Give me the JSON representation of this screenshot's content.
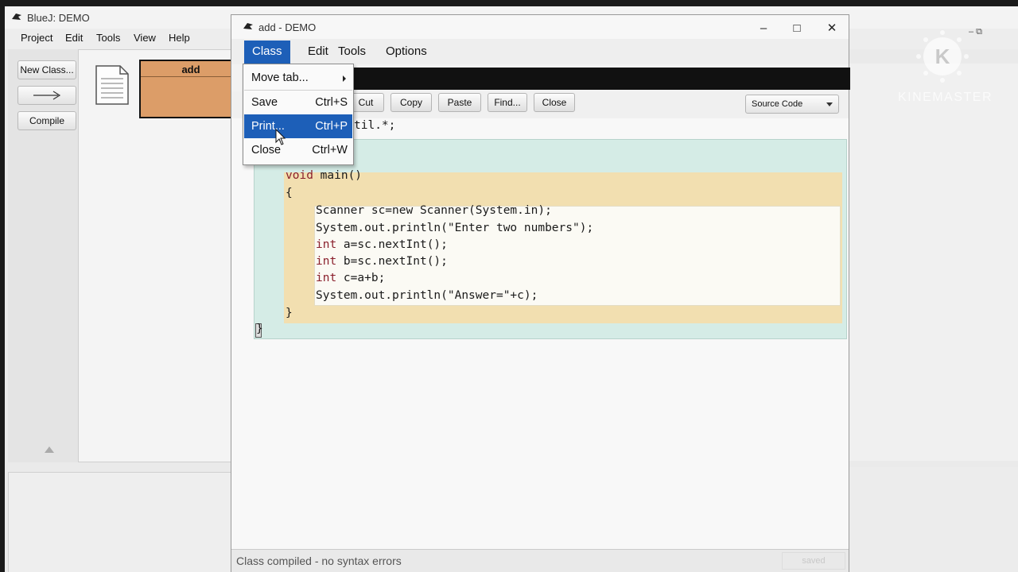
{
  "main_window": {
    "title": "BlueJ: DEMO",
    "menu": [
      "Project",
      "Edit",
      "Tools",
      "View",
      "Help"
    ],
    "left_buttons": {
      "new_class": "New Class...",
      "arrow": "→",
      "compile": "Compile"
    },
    "class_box_name": "add",
    "window_controls_right": "–  ⧉"
  },
  "editor": {
    "title": "add - DEMO",
    "window_controls": {
      "minimize": "–",
      "maximize": "□",
      "close": "✕"
    },
    "menu": [
      "Class",
      "Edit",
      "Tools",
      "Options"
    ],
    "toolbar": {
      "cut": "Cut",
      "copy": "Copy",
      "paste": "Paste",
      "find": "Find...",
      "close": "Close",
      "view_select": "Source Code"
    },
    "code": {
      "import_fragment": "til.*;",
      "method_sig_kw": "void",
      "method_sig_rest": " main()",
      "open_brace": "{",
      "lines": [
        "Scanner sc=new Scanner(System.in);",
        "System.out.println(\"Enter two numbers\");",
        "int a=sc.nextInt();",
        "int b=sc.nextInt();",
        "int c=a+b;",
        "System.out.println(\"Answer=\"+c);"
      ],
      "close_method_brace": "}",
      "close_class_brace": "}"
    },
    "status": "Class compiled - no syntax errors",
    "saved": "saved"
  },
  "dropdown": {
    "items": [
      {
        "label": "Move tab...",
        "shortcut": ""
      },
      {
        "label": "Save",
        "shortcut": "Ctrl+S"
      },
      {
        "label": "Print...",
        "shortcut": "Ctrl+P"
      },
      {
        "label": "Close",
        "shortcut": "Ctrl+W"
      }
    ],
    "selected_index": 2
  },
  "watermark": {
    "text": "KINEMASTER",
    "logo_letter": "K"
  },
  "colors": {
    "menu_highlight": "#1d5fb8",
    "class_box": "#dc9d68",
    "scope_class": "#d5ece6",
    "scope_method": "#f2dfb0",
    "keyword": "#8a1f2c"
  }
}
